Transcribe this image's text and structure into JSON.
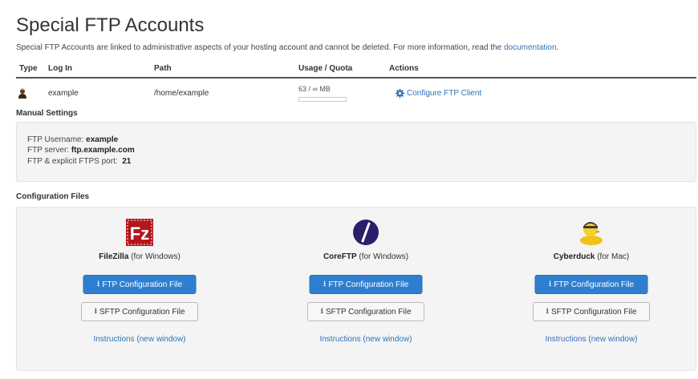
{
  "page": {
    "title": "Special FTP Accounts",
    "description": "Special FTP Accounts are linked to administrative aspects of your hosting account and cannot be deleted. For more information, read the ",
    "doc_link": "documentation",
    "doc_period": "."
  },
  "table": {
    "headers": {
      "type": "Type",
      "login": "Log In",
      "path": "Path",
      "usage": "Usage / Quota",
      "actions": "Actions"
    },
    "row": {
      "login": "example",
      "path": "/home/example",
      "usage": "63 / ∞ MB",
      "usage_fraction": 0,
      "action": "Configure FTP Client"
    }
  },
  "manual": {
    "label": "Manual Settings",
    "username_label": "FTP Username: ",
    "username": "example",
    "server_label": "FTP server: ",
    "server": "ftp.example.com",
    "port_label": "FTP & explicit FTPS port:  ",
    "port": "21"
  },
  "config": {
    "label": "Configuration Files",
    "clients": [
      {
        "name": "FileZilla",
        "platform": " (for Windows)",
        "ftp_button": "FTP Configuration File",
        "sftp_button": "SFTP Configuration File",
        "instructions": "Instructions (new window)",
        "icon": "filezilla-icon"
      },
      {
        "name": "CoreFTP",
        "platform": " (for Windows)",
        "ftp_button": "FTP Configuration File",
        "sftp_button": "SFTP Configuration File",
        "instructions": "Instructions (new window)",
        "icon": "coreftp-icon"
      },
      {
        "name": "Cyberduck",
        "platform": " (for Mac)",
        "ftp_button": "FTP Configuration File",
        "sftp_button": "SFTP Configuration File",
        "instructions": "Instructions (new window)",
        "icon": "cyberduck-icon"
      }
    ]
  },
  "colors": {
    "link": "#2f73b8",
    "primary_button": "#2f7fd0",
    "panel": "#f4f4f4"
  }
}
